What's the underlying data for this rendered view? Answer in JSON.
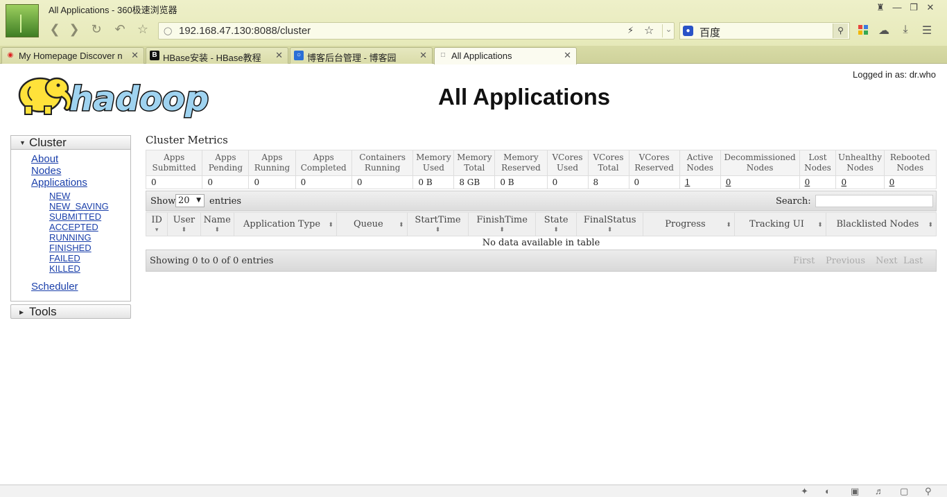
{
  "browser": {
    "window_title": "All Applications - 360极速浏览器",
    "url": "192.168.47.130:8088/cluster",
    "search_engine": "百度",
    "tabs": [
      {
        "label": "My Homepage Discover n",
        "icon": "weibo-icon"
      },
      {
        "label": "HBase安装 - HBase教程",
        "icon": "b-icon"
      },
      {
        "label": "博客后台管理 - 博客园",
        "icon": "blog-icon"
      },
      {
        "label": "All Applications",
        "icon": "page-icon"
      }
    ],
    "active_tab": 3
  },
  "header": {
    "logged_in": "Logged in as: dr.who",
    "title": "All Applications",
    "logo_text": "hadoop"
  },
  "sidebar": {
    "cluster_label": "Cluster",
    "links": [
      "About",
      "Nodes",
      "Applications"
    ],
    "app_states": [
      "NEW",
      "NEW_SAVING",
      "SUBMITTED",
      "ACCEPTED",
      "RUNNING",
      "FINISHED",
      "FAILED",
      "KILLED"
    ],
    "scheduler": "Scheduler",
    "tools_label": "Tools"
  },
  "metrics": {
    "title": "Cluster Metrics",
    "headers": [
      [
        "Apps",
        "Submitted"
      ],
      [
        "Apps",
        "Pending"
      ],
      [
        "Apps",
        "Running"
      ],
      [
        "Apps",
        "Completed"
      ],
      [
        "Containers",
        "Running"
      ],
      [
        "Memory",
        "Used"
      ],
      [
        "Memory",
        "Total"
      ],
      [
        "Memory",
        "Reserved"
      ],
      [
        "VCores",
        "Used"
      ],
      [
        "VCores",
        "Total"
      ],
      [
        "VCores",
        "Reserved"
      ],
      [
        "Active",
        "Nodes"
      ],
      [
        "Decommissioned",
        "Nodes"
      ],
      [
        "Lost",
        "Nodes"
      ],
      [
        "Unhealthy",
        "Nodes"
      ],
      [
        "Rebooted",
        "Nodes"
      ]
    ],
    "values": [
      "0",
      "0",
      "0",
      "0",
      "0",
      "0 B",
      "8 GB",
      "0 B",
      "0",
      "8",
      "0",
      "1",
      "0",
      "0",
      "0",
      "0"
    ],
    "linked": [
      false,
      false,
      false,
      false,
      false,
      false,
      false,
      false,
      false,
      false,
      false,
      true,
      true,
      true,
      true,
      true
    ]
  },
  "table": {
    "show_label": "Show",
    "entries_count": "20",
    "entries_label": "entries",
    "search_label": "Search:",
    "columns": [
      "ID",
      "User",
      "Name",
      "Application Type",
      "Queue",
      "StartTime",
      "FinishTime",
      "State",
      "FinalStatus",
      "Progress",
      "Tracking UI",
      "Blacklisted Nodes"
    ],
    "empty_message": "No data available in table",
    "info": "Showing 0 to 0 of 0 entries",
    "pagination": [
      "First",
      "Previous",
      "Next",
      "Last"
    ]
  }
}
